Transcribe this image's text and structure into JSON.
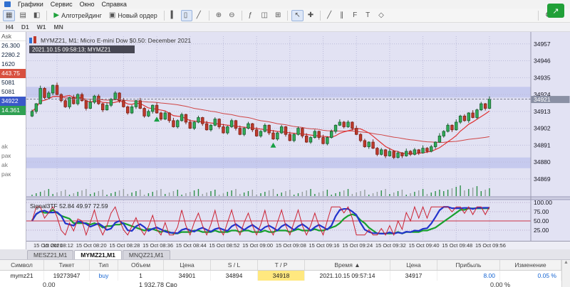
{
  "menubar": {
    "items": [
      "Графики",
      "Сервис",
      "Окно",
      "Справка"
    ]
  },
  "toolbar": {
    "algo_label": "Алготрейдинг",
    "new_order_label": "Новый ордер",
    "groups": [
      [
        {
          "name": "market-watch-toggle-icon",
          "glyph": "▦",
          "active": true
        },
        {
          "name": "data-window-icon",
          "glyph": "▤",
          "active": false
        },
        {
          "name": "navigator-icon",
          "glyph": "◧",
          "active": false
        }
      ],
      [
        {
          "name": "algo-trading-button",
          "glyph": "▶",
          "label": "Алготрейдинг",
          "green": true
        },
        {
          "name": "new-order-button",
          "glyph": "▣",
          "label": "Новый ордер"
        }
      ],
      [
        {
          "name": "bar-chart-icon",
          "glyph": "▍",
          "active": false
        },
        {
          "name": "candle-chart-icon",
          "glyph": "▯",
          "active": true
        },
        {
          "name": "line-chart-icon",
          "glyph": "╱",
          "active": false
        }
      ],
      [
        {
          "name": "zoom-in-icon",
          "glyph": "⊕"
        },
        {
          "name": "zoom-out-icon",
          "glyph": "⊖"
        }
      ],
      [
        {
          "name": "indicators-icon",
          "glyph": "ƒ"
        },
        {
          "name": "objects-icon",
          "glyph": "◫"
        },
        {
          "name": "grid-icon",
          "glyph": "⊞"
        }
      ],
      [
        {
          "name": "cursor-icon",
          "glyph": "↖",
          "active": true
        },
        {
          "name": "crosshair-icon",
          "glyph": "✚"
        }
      ],
      [
        {
          "name": "trendline-icon",
          "glyph": "╱"
        },
        {
          "name": "channel-icon",
          "glyph": "∥"
        },
        {
          "name": "fibonacci-icon",
          "glyph": "F"
        },
        {
          "name": "text-icon",
          "glyph": "T"
        },
        {
          "name": "shapes-icon",
          "glyph": "◇"
        }
      ],
      [
        {
          "name": "settings-icon",
          "glyph": "⚙"
        },
        {
          "name": "dropdown-icon",
          "glyph": "▾"
        }
      ]
    ],
    "timeframes": [
      "H4",
      "D1",
      "W1",
      "MN"
    ]
  },
  "market_watch": {
    "header": "Ask",
    "rows": [
      {
        "value": "26.300",
        "hl": ""
      },
      {
        "value": "2280.2",
        "hl": ""
      },
      {
        "value": "1620",
        "hl": ""
      },
      {
        "value": "443.75",
        "hl": "down"
      },
      {
        "value": "5081",
        "hl": ""
      },
      {
        "value": "5081",
        "hl": ""
      },
      {
        "value": "34922",
        "hl": "blue"
      },
      {
        "value": "14.361",
        "hl": "green"
      }
    ],
    "fragments": [
      "ak",
      "рак",
      "ak",
      "рак"
    ]
  },
  "chart": {
    "title": "MYMZ21, M1: Micro E-mini Dow $0.50: December 2021",
    "tooltip": "2021.10.15 09:58:13; MYMZ21",
    "current_price": "34921",
    "price_labels": [
      "34957",
      "34946",
      "34935",
      "34924",
      "34913",
      "34902",
      "34891",
      "34880",
      "34869"
    ],
    "time_labels": [
      "15 Oct 2021",
      "15 Oct 08:12",
      "15 Oct 08:20",
      "15 Oct 08:28",
      "15 Oct 08:36",
      "15 Oct 08:44",
      "15 Oct 08:52",
      "15 Oct 09:00",
      "15 Oct 09:08",
      "15 Oct 09:16",
      "15 Oct 09:24",
      "15 Oct 09:32",
      "15 Oct 09:40",
      "15 Oct 09:48",
      "15 Oct 09:56"
    ]
  },
  "indicator": {
    "label": "Signal3TF 52.84 49.97 72.59",
    "levels": [
      "100.00",
      "75.00",
      "50.00",
      "25.00"
    ]
  },
  "chart_tabs": [
    {
      "label": "MESZ21,M1",
      "active": false
    },
    {
      "label": "MYMZ21,M1",
      "active": true
    },
    {
      "label": "MNQZ21,M1",
      "active": false
    }
  ],
  "toolbox": {
    "headers": [
      "Символ",
      "Тикет",
      "Тип",
      "Объем",
      "Цена",
      "S / L",
      "T / P",
      "Время ▲",
      "Цена",
      "Прибыль",
      "Изменение"
    ],
    "row": [
      "mymz21",
      "19273947",
      "buy",
      "1",
      "34901",
      "34894",
      "34918",
      "2021.10.15 09:57:14",
      "34917",
      "8.00",
      "0.05 %"
    ],
    "footer": {
      "f1": "0.00",
      "f2": "1 932.78  Сво",
      "f3": "0.00 %"
    }
  },
  "chart_data": {
    "type": "candlestick",
    "symbol": "MYMZ21",
    "period": "M1",
    "time_start": "2021.10.15 08:06",
    "step_minutes": 1,
    "price_range": [
      34857,
      34962
    ],
    "first_open": 34910,
    "closes": [
      34913,
      34918,
      34928,
      34922,
      34925,
      34930,
      34924,
      34920,
      34916,
      34922,
      34918,
      34924,
      34920,
      34915,
      34919,
      34923,
      34918,
      34914,
      34917,
      34921,
      34925,
      34920,
      34916,
      34912,
      34916,
      34920,
      34915,
      34910,
      34913,
      34917,
      34912,
      34908,
      34912,
      34907,
      34903,
      34907,
      34911,
      34906,
      34902,
      34906,
      34909,
      34905,
      34901,
      34904,
      34908,
      34903,
      34899,
      34903,
      34907,
      34902,
      34898,
      34902,
      34905,
      34901,
      34897,
      34900,
      34904,
      34899,
      34895,
      34899,
      34903,
      34898,
      34894,
      34898,
      34902,
      34897,
      34893,
      34896,
      34900,
      34896,
      34892,
      34896,
      34900,
      34904,
      34906,
      34903,
      34906,
      34902,
      34898,
      34894,
      34890,
      34893,
      34889,
      34885,
      34888,
      34884,
      34887,
      34883,
      34886,
      34884,
      34887,
      34885,
      34888,
      34886,
      34889,
      34887,
      34890,
      34893,
      34897,
      34900,
      34904,
      34901,
      34906,
      34910,
      34907,
      34912,
      34909,
      34914,
      34918,
      34915,
      34921
    ],
    "bands": [
      [
        34922,
        34929
      ],
      [
        34876,
        34883
      ]
    ],
    "current_price": 34921,
    "indicator_values": [
      52.84,
      49.97,
      72.59
    ]
  }
}
